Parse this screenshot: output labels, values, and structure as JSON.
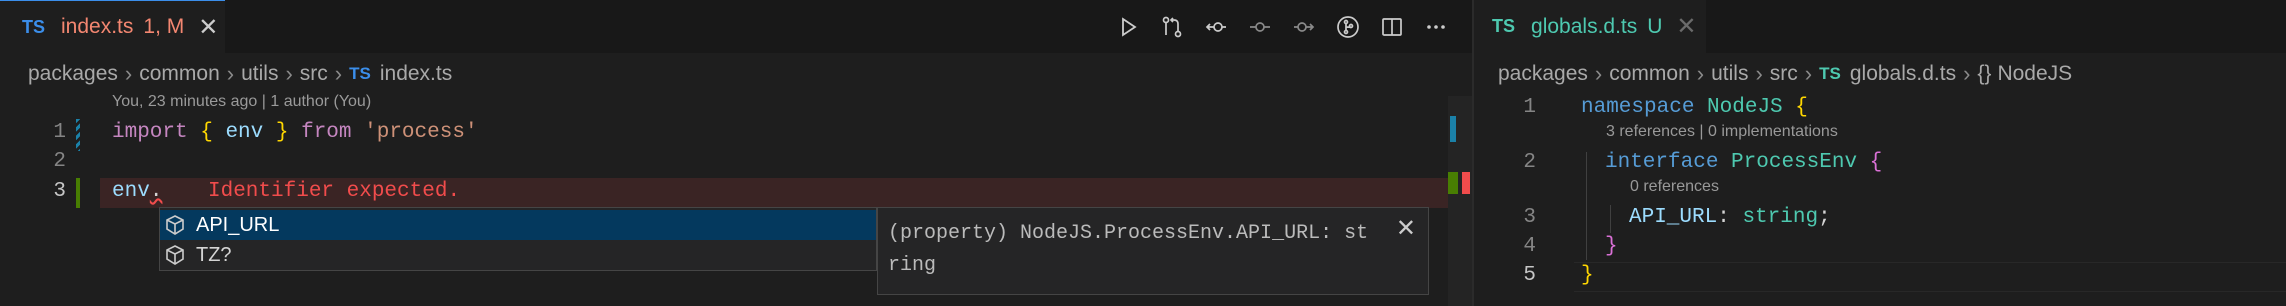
{
  "left_editor": {
    "tab": {
      "lang_badge": "TS",
      "filename": "index.ts",
      "status": "1, M",
      "close": "✕"
    },
    "actions": [
      {
        "icon": "run-icon"
      },
      {
        "icon": "compare-changes-icon"
      },
      {
        "icon": "go-back-icon"
      },
      {
        "icon": "git-commit-icon"
      },
      {
        "icon": "go-forward-icon"
      },
      {
        "icon": "git-graph-icon"
      },
      {
        "icon": "split-editor-icon"
      },
      {
        "icon": "more-actions-icon"
      }
    ],
    "breadcrumbs": [
      "packages",
      "common",
      "utils",
      "src"
    ],
    "breadcrumb_file": {
      "lang_badge": "TS",
      "name": "index.ts"
    },
    "blame": "You, 23 minutes ago | 1 author (You)",
    "lines": [
      {
        "number": "1",
        "kw": "import",
        "open": "{",
        "name": "env",
        "close": "}",
        "from": "from",
        "str": "'process'"
      },
      {
        "number": "2"
      },
      {
        "number": "3",
        "var": "env",
        "dot": ".",
        "error": "Identifier expected."
      }
    ],
    "suggestions": [
      {
        "label": "API_URL",
        "icon": "property-cube-icon",
        "selected": true
      },
      {
        "label": "TZ?",
        "icon": "property-cube-icon",
        "selected": false
      }
    ],
    "details": {
      "text": "(property) NodeJS.ProcessEnv.API_URL: string",
      "close": "✕"
    }
  },
  "right_editor": {
    "tab": {
      "lang_badge": "TS",
      "filename": "globals.d.ts",
      "status": "U",
      "close": "✕"
    },
    "breadcrumbs": [
      "packages",
      "common",
      "utils",
      "src"
    ],
    "breadcrumb_file": {
      "lang_badge": "TS",
      "name": "globals.d.ts"
    },
    "breadcrumb_symbol": {
      "glyph": "{}",
      "name": "NodeJS"
    },
    "lines": [
      {
        "number": "1",
        "kw": "namespace",
        "name": "NodeJS",
        "brace": "{"
      },
      {
        "number": "2",
        "kw": "interface",
        "name": "ProcessEnv",
        "brace": "{"
      },
      {
        "number": "3",
        "prop": "API_URL",
        "colon": ":",
        "type": "string",
        "semi": ";"
      },
      {
        "number": "4",
        "brace": "}"
      },
      {
        "number": "5",
        "brace": "}"
      }
    ],
    "codelens": [
      "3 references | 0 implementations",
      "0 references"
    ]
  },
  "colors": {
    "ts_badge_left": "#3b8eea",
    "ts_badge_right": "#4ec9b0",
    "error": "#f14c4c",
    "modified": "#e2c08d"
  }
}
